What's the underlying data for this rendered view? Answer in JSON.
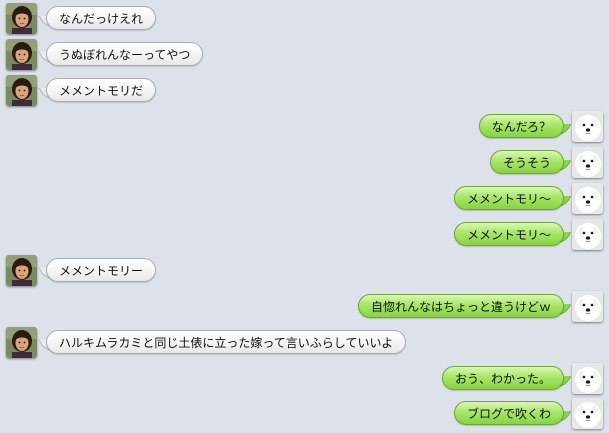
{
  "messages": [
    {
      "side": "left",
      "sender": "woman",
      "text": "なんだっけえれ"
    },
    {
      "side": "left",
      "sender": "woman",
      "text": "うぬぼれんなーってやつ"
    },
    {
      "side": "left",
      "sender": "woman",
      "text": "メメントモリだ"
    },
    {
      "side": "right",
      "sender": "dog",
      "text": "なんだろ？"
    },
    {
      "side": "right",
      "sender": "dog",
      "text": "そうそう"
    },
    {
      "side": "right",
      "sender": "dog",
      "text": "メメントモリ〜"
    },
    {
      "side": "right",
      "sender": "dog",
      "text": "メメントモリ〜"
    },
    {
      "side": "left",
      "sender": "woman",
      "text": "メメントモリー"
    },
    {
      "side": "right",
      "sender": "dog",
      "text": "自惚れんなはちょっと違うけどｗ"
    },
    {
      "side": "left",
      "sender": "woman",
      "text": "ハルキムラカミと同じ土俵に立った嫁って言いふらしていいよ"
    },
    {
      "side": "right",
      "sender": "dog",
      "text": "おう、わかった。"
    },
    {
      "side": "right",
      "sender": "dog",
      "text": "ブログで吹くわ"
    }
  ],
  "colors": {
    "background": "#dde2ea",
    "incoming_bubble": "#f4f4f4",
    "outgoing_bubble": "#a8e66a"
  },
  "avatars": {
    "woman": "woman-avatar-icon",
    "dog": "white-dog-avatar-icon"
  }
}
